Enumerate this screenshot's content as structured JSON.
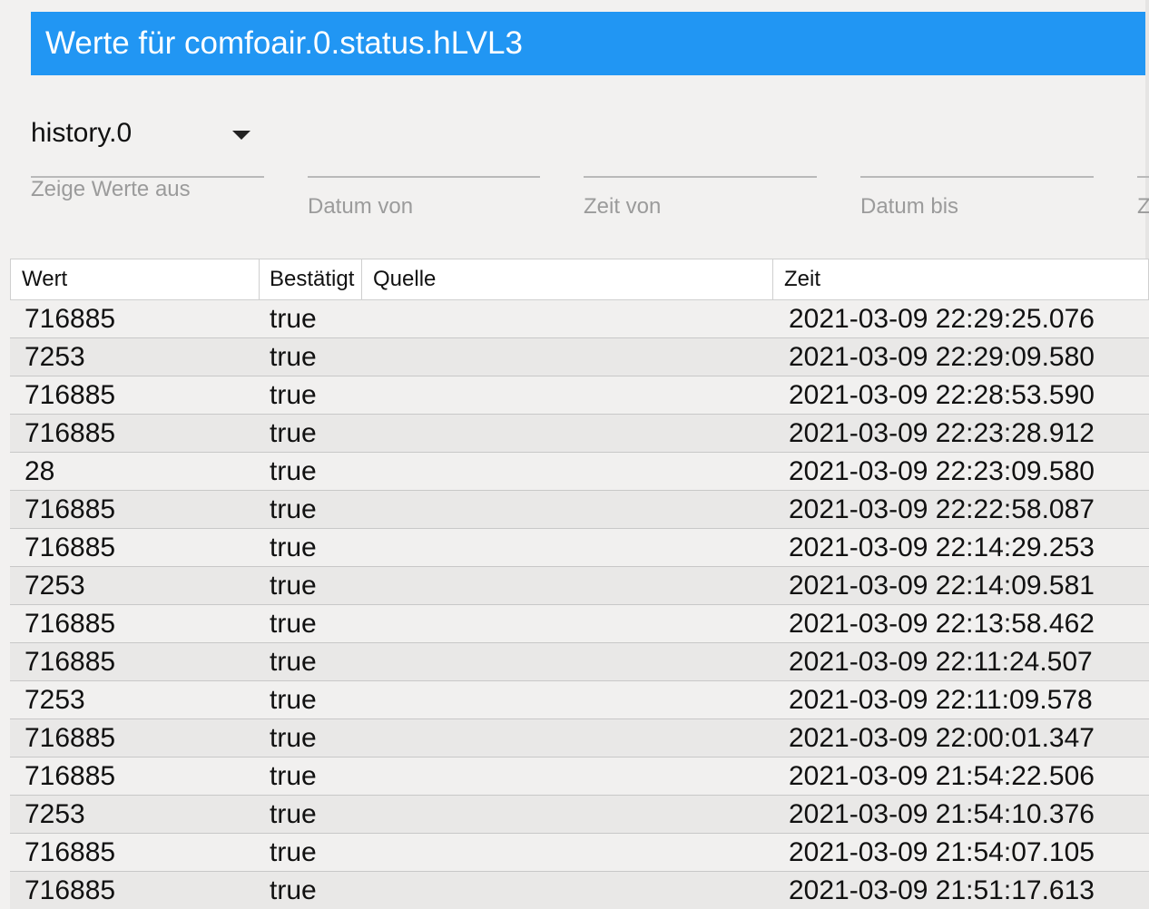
{
  "title": "Werte für comfoair.0.status.hLVL3",
  "filters": {
    "instance": {
      "value": "history.0",
      "label": "Zeige Werte aus"
    },
    "date_from": {
      "label": "Datum von"
    },
    "time_from": {
      "label": "Zeit von"
    },
    "date_to": {
      "label": "Datum bis"
    },
    "time_to": {
      "label": "Z"
    }
  },
  "table": {
    "headers": {
      "wert": "Wert",
      "ack": "Bestätigt",
      "source": "Quelle",
      "time": "Zeit"
    },
    "rows": [
      {
        "wert": "716885",
        "ack": "true",
        "source": "",
        "time": "2021-03-09 22:29:25.076"
      },
      {
        "wert": "7253",
        "ack": "true",
        "source": "",
        "time": "2021-03-09 22:29:09.580"
      },
      {
        "wert": "716885",
        "ack": "true",
        "source": "",
        "time": "2021-03-09 22:28:53.590"
      },
      {
        "wert": "716885",
        "ack": "true",
        "source": "",
        "time": "2021-03-09 22:23:28.912"
      },
      {
        "wert": "28",
        "ack": "true",
        "source": "",
        "time": "2021-03-09 22:23:09.580"
      },
      {
        "wert": "716885",
        "ack": "true",
        "source": "",
        "time": "2021-03-09 22:22:58.087"
      },
      {
        "wert": "716885",
        "ack": "true",
        "source": "",
        "time": "2021-03-09 22:14:29.253"
      },
      {
        "wert": "7253",
        "ack": "true",
        "source": "",
        "time": "2021-03-09 22:14:09.581"
      },
      {
        "wert": "716885",
        "ack": "true",
        "source": "",
        "time": "2021-03-09 22:13:58.462"
      },
      {
        "wert": "716885",
        "ack": "true",
        "source": "",
        "time": "2021-03-09 22:11:24.507"
      },
      {
        "wert": "7253",
        "ack": "true",
        "source": "",
        "time": "2021-03-09 22:11:09.578"
      },
      {
        "wert": "716885",
        "ack": "true",
        "source": "",
        "time": "2021-03-09 22:00:01.347"
      },
      {
        "wert": "716885",
        "ack": "true",
        "source": "",
        "time": "2021-03-09 21:54:22.506"
      },
      {
        "wert": "7253",
        "ack": "true",
        "source": "",
        "time": "2021-03-09 21:54:10.376"
      },
      {
        "wert": "716885",
        "ack": "true",
        "source": "",
        "time": "2021-03-09 21:54:07.105"
      },
      {
        "wert": "716885",
        "ack": "true",
        "source": "",
        "time": "2021-03-09 21:51:17.613"
      }
    ]
  },
  "colors": {
    "accent": "#2196f3",
    "background": "#f2f1f0",
    "row_odd": "#f1f0ef",
    "row_even": "#e9e8e7"
  },
  "icons": {
    "dropdown": "caret-down-icon"
  }
}
